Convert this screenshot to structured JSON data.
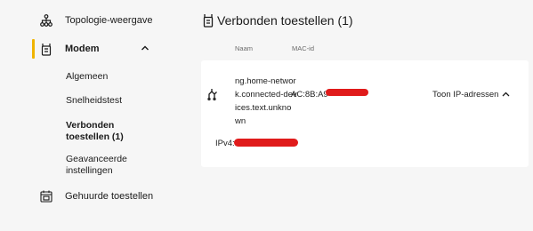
{
  "sidebar": {
    "items": [
      {
        "label": "Topologie-weergave",
        "icon": "topology-icon"
      },
      {
        "label": "Modem",
        "icon": "modem-icon"
      },
      {
        "label": "Gehuurde toestellen",
        "icon": "rented-devices-icon"
      }
    ],
    "modem_subitems": [
      {
        "label": "Algemeen"
      },
      {
        "label": "Snelheidstest"
      },
      {
        "label": "Verbonden toestellen (1)"
      },
      {
        "label": "Geavanceerde instellingen"
      }
    ],
    "accent_color": "#f0b400"
  },
  "main": {
    "title": "Verbonden toestellen (1)",
    "columns": {
      "name": "Naam",
      "mac": "MAC-id"
    },
    "device": {
      "name": "ng.home-network.connected-devices.text.unknown",
      "mac_prefix": "AC:8B:A9",
      "ipv4_label": "IPv4:",
      "show_ip_label": "Toon IP-adressen"
    }
  },
  "redaction_color": "#e01b1b"
}
